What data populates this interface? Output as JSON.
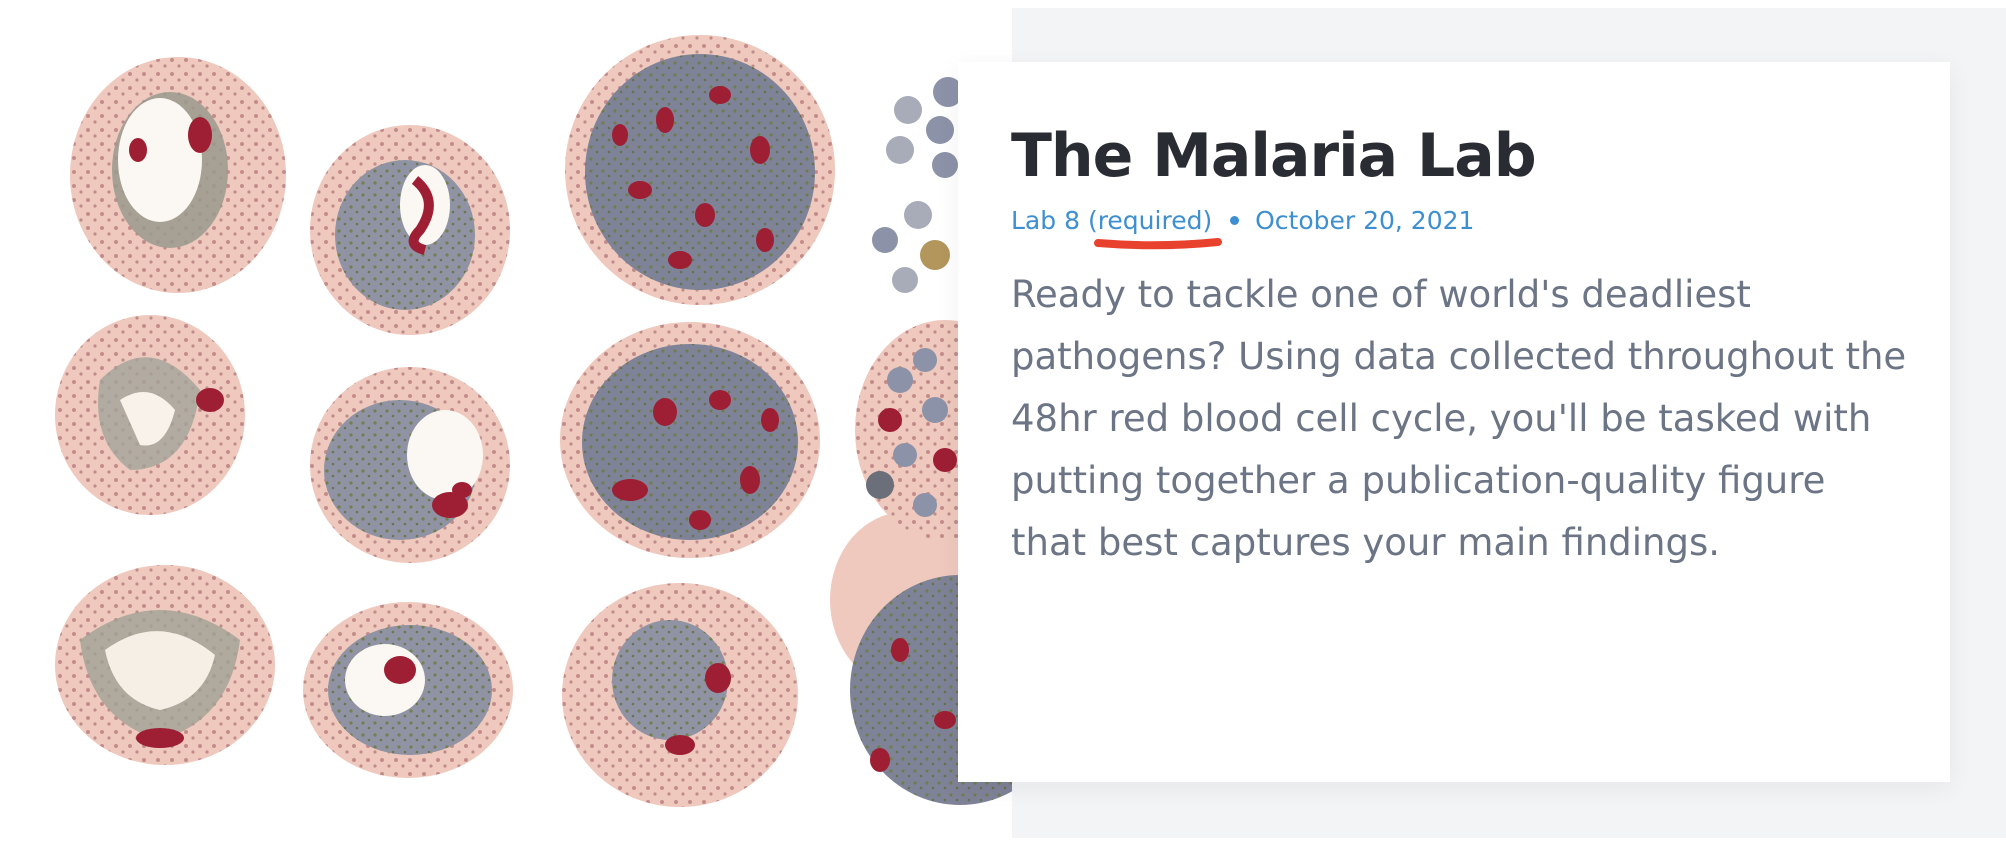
{
  "post": {
    "title": "The Malaria Lab",
    "lab_label": "Lab 8",
    "required_label": "(required)",
    "date": "October 20, 2021",
    "description": "Ready to tackle one of world's deadliest pathogens? Using data collected throughout the 48hr red blood cell cycle, you'll be tasked with putting together a publication-quality figure that best captures your main findings."
  },
  "colors": {
    "title": "#2a2c33",
    "meta_link": "#3d8fd1",
    "description": "#6c7585",
    "annotation_underline": "#e8422f",
    "background_panel": "#f3f4f6"
  }
}
